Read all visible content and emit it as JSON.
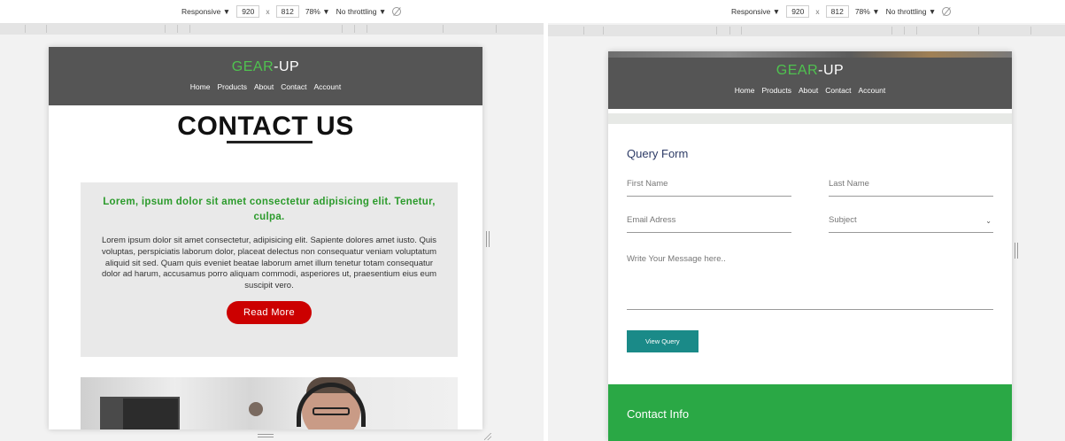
{
  "devtools": {
    "device": "Responsive ▼",
    "width": "920",
    "times": "x",
    "height": "812",
    "zoom": "78% ▼",
    "throttling": "No throttling ▼"
  },
  "site": {
    "logo_part1": "GEAR",
    "logo_part2": "-UP",
    "nav": [
      "Home",
      "Products",
      "About",
      "Contact",
      "Account"
    ]
  },
  "left_page": {
    "title": "CONTACT US",
    "lorem_heading": "Lorem, ipsum dolor sit amet consectetur adipisicing elit. Tenetur, culpa.",
    "lorem_body": "Lorem ipsum dolor sit amet consectetur, adipisicing elit. Sapiente dolores amet iusto. Quis voluptas, perspiciatis laborum dolor, placeat delectus non consequatur veniam voluptatum aliquid sit sed. Quam quis eveniet beatae laborum amet illum tenetur totam consequatur dolor ad harum, accusamus porro aliquam commodi, asperiores ut, praesentium eius eum suscipit vero.",
    "read_more": "Read More"
  },
  "right_page": {
    "form_title": "Query Form",
    "first_name": "First Name",
    "last_name": "Last Name",
    "email": "Email Adress",
    "subject": "Subject",
    "message": "Write Your Message here..",
    "view_query": "View Query",
    "contact_info": "Contact Info"
  },
  "colors": {
    "nav_bg": "#555555",
    "logo_green": "#4fc24f",
    "heading_green": "#2c9b2c",
    "read_more_red": "#cc0000",
    "view_btn_teal": "#1a8a88",
    "contact_info_green": "#2aa845"
  }
}
